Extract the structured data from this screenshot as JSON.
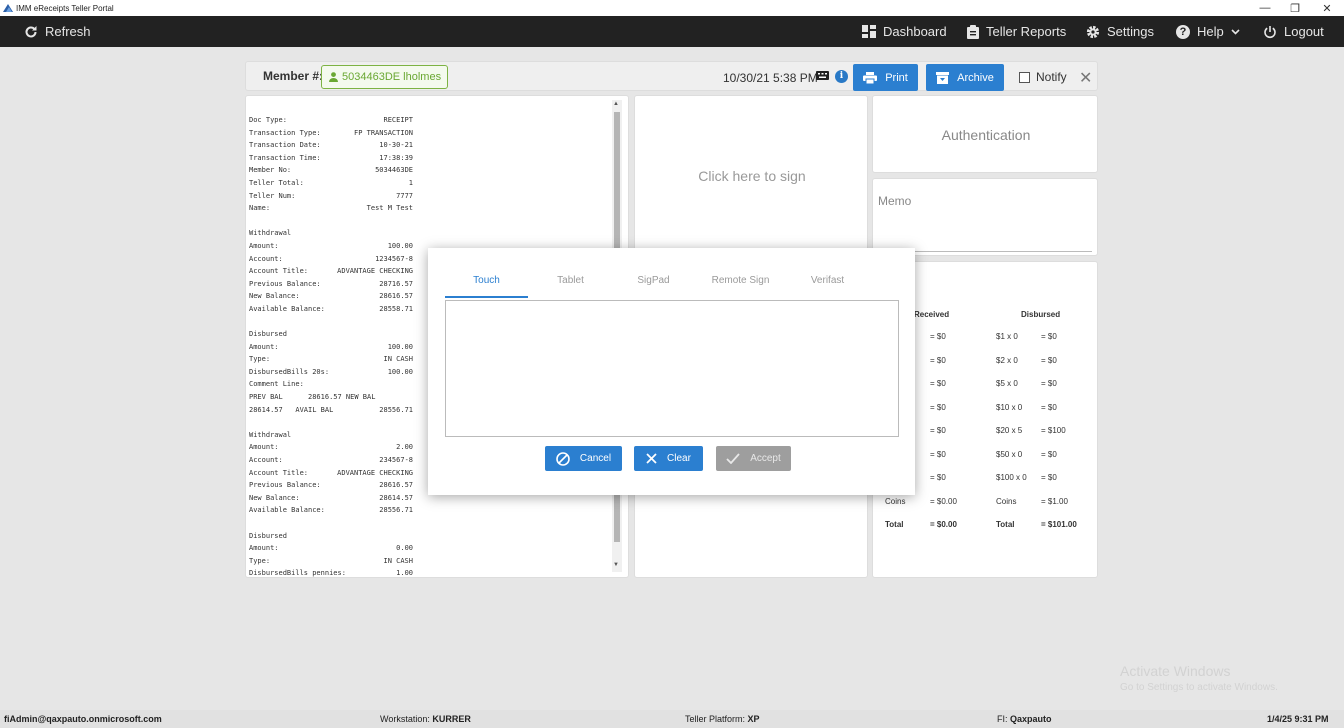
{
  "window": {
    "title": "IMM eReceipts Teller Portal",
    "controls": [
      "—",
      "❐",
      "✕"
    ]
  },
  "nav": {
    "refresh": "Refresh",
    "dashboard": "Dashboard",
    "teller_reports": "Teller Reports",
    "settings": "Settings",
    "help": "Help",
    "logout": "Logout"
  },
  "member": {
    "label": "Member #:",
    "chip": "5034463DE lholmes",
    "datetime": "10/30/21 5:38 PM",
    "print": "Print",
    "archive": "Archive",
    "notify": "Notify"
  },
  "receipt": {
    "lines": [
      [
        "Doc Type:",
        "RECEIPT"
      ],
      [
        "Transaction Type:",
        "FP TRANSACTION"
      ],
      [
        "Transaction Date:",
        "10-30-21"
      ],
      [
        "Transaction Time:",
        "17:38:39"
      ],
      [
        "Member No:",
        "5034463DE"
      ],
      [
        "Teller Total:",
        "1"
      ],
      [
        "Teller Num:",
        "7777"
      ],
      [
        "Name:",
        "Test M Test"
      ],
      [
        "",
        ""
      ],
      [
        "Withdrawal",
        ""
      ],
      [
        "Amount:",
        "100.00"
      ],
      [
        "Account:",
        "1234567-8"
      ],
      [
        "Account Title:",
        "ADVANTAGE CHECKING"
      ],
      [
        "Previous Balance:",
        "28716.57"
      ],
      [
        "New Balance:",
        "28616.57"
      ],
      [
        "Available Balance:",
        "28558.71"
      ],
      [
        "",
        ""
      ],
      [
        "Disbursed",
        ""
      ],
      [
        "Amount:",
        "100.00"
      ],
      [
        "Type:",
        "IN CASH"
      ],
      [
        "DisbursedBills 20s:",
        "100.00"
      ],
      [
        "Comment Line:",
        ""
      ],
      [
        "PREV BAL      28616.57 NEW BAL",
        ""
      ],
      [
        "28614.57   AVAIL BAL",
        "28556.71"
      ],
      [
        "",
        ""
      ],
      [
        "Withdrawal",
        ""
      ],
      [
        "Amount:",
        "2.00"
      ],
      [
        "Account:",
        "234567-8"
      ],
      [
        "Account Title:",
        "ADVANTAGE CHECKING"
      ],
      [
        "Previous Balance:",
        "28616.57"
      ],
      [
        "New Balance:",
        "28614.57"
      ],
      [
        "Available Balance:",
        "28556.71"
      ],
      [
        "",
        ""
      ],
      [
        "Disbursed",
        ""
      ],
      [
        "Amount:",
        "0.00"
      ],
      [
        "Type:",
        "IN CASH"
      ],
      [
        "DisbursedBills pennies:",
        "1.00"
      ]
    ]
  },
  "sign_panel": {
    "text": "Click here to sign"
  },
  "auth_panel": {
    "text": "Authentication"
  },
  "memo_panel": {
    "text": "Memo"
  },
  "cash": {
    "received_header": "Received",
    "disbursed_header": "Disbursed",
    "received_rows": [
      "= $0",
      "= $0",
      "= $0",
      "= $0",
      "= $0",
      "= $0",
      "= $0"
    ],
    "disbursed_rows": [
      [
        "$1 x 0",
        "= $0"
      ],
      [
        "$2 x 0",
        "= $0"
      ],
      [
        "$5 x 0",
        "= $0"
      ],
      [
        "$10 x 0",
        "= $0"
      ],
      [
        "$20 x 5",
        "= $100"
      ],
      [
        "$50 x 0",
        "= $0"
      ],
      [
        "$100 x 0",
        "= $0"
      ]
    ],
    "coins_label": "Coins",
    "coins_received": "= $0.00",
    "coins_disbursed": "= $1.00",
    "total_label": "Total",
    "total_received": "= $0.00",
    "total_disbursed": "= $101.00"
  },
  "modal": {
    "tabs": [
      "Touch",
      "Tablet",
      "SigPad",
      "Remote Sign",
      "Verifast"
    ],
    "active_tab": "Touch",
    "cancel": "Cancel",
    "clear": "Clear",
    "accept": "Accept"
  },
  "watermark": {
    "line1": "Activate Windows",
    "line2": "Go to Settings to activate Windows."
  },
  "status": {
    "user": "fiAdmin@qaxpauto.onmicrosoft.com",
    "workstation_label": "Workstation:",
    "workstation": "KURRER",
    "platform_label": "Teller Platform:",
    "platform": "XP",
    "fi_label": "FI:",
    "fi": "Qaxpauto",
    "clock": "1/4/25 9:31 PM"
  },
  "colors": {
    "nav_bg": "#222222",
    "primary": "#2b7fd0",
    "member_green": "#6aa833",
    "accept_disabled": "#9e9e9e"
  }
}
